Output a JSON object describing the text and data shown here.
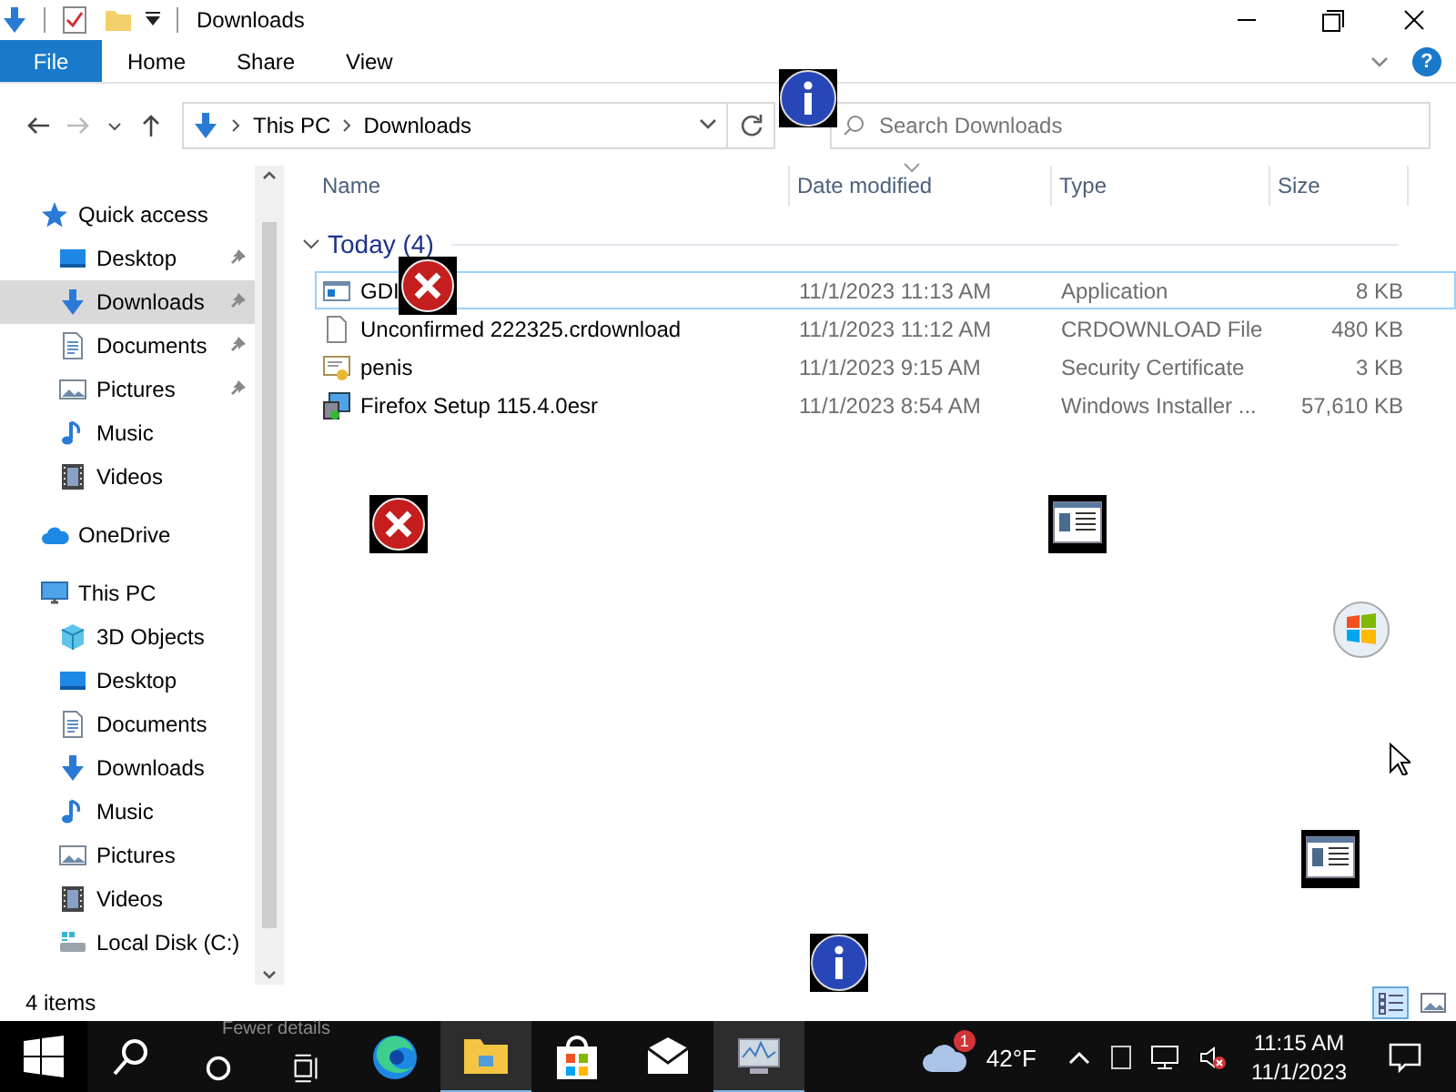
{
  "window": {
    "title": "Downloads"
  },
  "ribbon_tabs": [
    {
      "label": "File",
      "kind": "file"
    },
    {
      "label": "Home",
      "kind": "tab"
    },
    {
      "label": "Share",
      "kind": "tab"
    },
    {
      "label": "View",
      "kind": "tab"
    }
  ],
  "help_button": "?",
  "address": {
    "path": [
      "This PC",
      "Downloads"
    ]
  },
  "search": {
    "placeholder": "Search Downloads"
  },
  "navigation": [
    {
      "label": "Quick access",
      "kind": "star",
      "selected": false,
      "children": [
        {
          "label": "Desktop",
          "kind": "desktop",
          "pinned": true,
          "selected": false
        },
        {
          "label": "Downloads",
          "kind": "download",
          "pinned": true,
          "selected": true
        },
        {
          "label": "Documents",
          "kind": "documents",
          "pinned": true,
          "selected": false
        },
        {
          "label": "Pictures",
          "kind": "pictures",
          "pinned": true,
          "selected": false
        },
        {
          "label": "Music",
          "kind": "music",
          "pinned": false,
          "selected": false
        },
        {
          "label": "Videos",
          "kind": "videos",
          "pinned": false,
          "selected": false
        }
      ]
    },
    {
      "label": "OneDrive",
      "kind": "cloud",
      "selected": false
    },
    {
      "label": "This PC",
      "kind": "pc",
      "selected": false,
      "children": [
        {
          "label": "3D Objects",
          "kind": "cube",
          "pinned": false,
          "selected": false
        },
        {
          "label": "Desktop",
          "kind": "desktop",
          "pinned": false,
          "selected": false
        },
        {
          "label": "Documents",
          "kind": "documents",
          "pinned": false,
          "selected": false
        },
        {
          "label": "Downloads",
          "kind": "download",
          "pinned": false,
          "selected": false
        },
        {
          "label": "Music",
          "kind": "music",
          "pinned": false,
          "selected": false
        },
        {
          "label": "Pictures",
          "kind": "pictures",
          "pinned": false,
          "selected": false
        },
        {
          "label": "Videos",
          "kind": "videos",
          "pinned": false,
          "selected": false
        },
        {
          "label": "Local Disk (C:)",
          "kind": "disk",
          "pinned": false,
          "selected": false
        }
      ]
    }
  ],
  "columns": [
    {
      "label": "Name",
      "sorted": false
    },
    {
      "label": "Date modified",
      "sorted": true
    },
    {
      "label": "Type",
      "sorted": false
    },
    {
      "label": "Size",
      "sorted": false
    }
  ],
  "groups": [
    {
      "label": "Today (4)",
      "expanded": true,
      "files": [
        {
          "name": "GDI",
          "kind": "application",
          "date": "11/1/2023 11:13 AM",
          "type": "Application",
          "size": "8 KB",
          "selected": true
        },
        {
          "name": "Unconfirmed 222325.crdownload",
          "kind": "blank",
          "date": "11/1/2023 11:12 AM",
          "type": "CRDOWNLOAD File",
          "size": "480 KB",
          "selected": false
        },
        {
          "name": "penis",
          "kind": "certificate",
          "date": "11/1/2023 9:15 AM",
          "type": "Security Certificate",
          "size": "3 KB",
          "selected": false
        },
        {
          "name": "Firefox Setup 115.4.0esr",
          "kind": "installer",
          "date": "11/1/2023 8:54 AM",
          "type": "Windows Installer ...",
          "size": "57,610 KB",
          "selected": false
        }
      ]
    }
  ],
  "status_bar": {
    "item_count": "4 items",
    "views": [
      {
        "kind": "details",
        "selected": true
      },
      {
        "kind": "large-icons",
        "selected": false
      }
    ]
  },
  "taskbar": {
    "ghost_text": "Fewer details",
    "apps": [
      {
        "kind": "edge",
        "active": false
      },
      {
        "kind": "explorer",
        "active": true
      },
      {
        "kind": "store",
        "active": false
      },
      {
        "kind": "mail",
        "active": false
      },
      {
        "kind": "monitor",
        "active": true
      }
    ],
    "weather_badge": "1",
    "temperature": "42°F",
    "time": "11:15 AM",
    "date": "11/1/2023"
  },
  "overlay_icons": [
    {
      "kind": "info"
    },
    {
      "kind": "error"
    },
    {
      "kind": "error"
    },
    {
      "kind": "window"
    },
    {
      "kind": "windows-logo"
    },
    {
      "kind": "window"
    },
    {
      "kind": "info"
    }
  ]
}
